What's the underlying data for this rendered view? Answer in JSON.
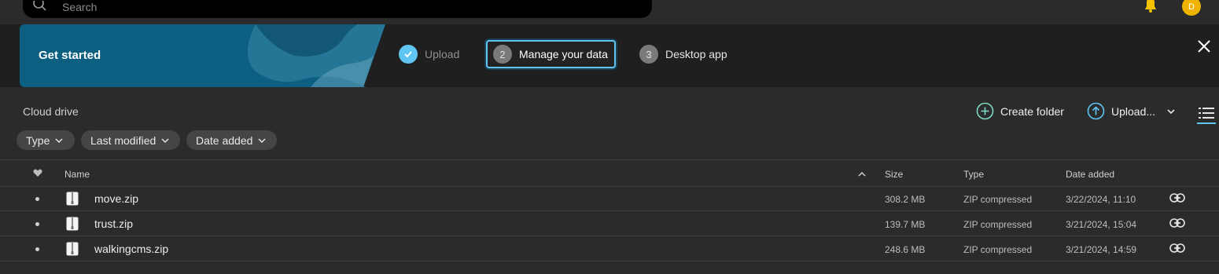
{
  "search": {
    "placeholder": "Search"
  },
  "header": {
    "avatar_initial": "D"
  },
  "banner": {
    "title": "Get started",
    "steps": [
      {
        "number": "",
        "label": "Upload",
        "state": "done"
      },
      {
        "number": "2",
        "label": "Manage your data",
        "state": "active"
      },
      {
        "number": "3",
        "label": "Desktop app",
        "state": "pending"
      }
    ]
  },
  "toolbar": {
    "breadcrumb": "Cloud drive",
    "create_folder": "Create folder",
    "upload": "Upload..."
  },
  "filters": [
    "Type",
    "Last modified",
    "Date added"
  ],
  "table": {
    "columns": {
      "name": "Name",
      "size": "Size",
      "type": "Type",
      "date_added": "Date added"
    },
    "rows": [
      {
        "name": "move.zip",
        "size": "308.2 MB",
        "type": "ZIP compressed",
        "date_added": "3/22/2024, 11:10"
      },
      {
        "name": "trust.zip",
        "size": "139.7 MB",
        "type": "ZIP compressed",
        "date_added": "3/21/2024, 15:04"
      },
      {
        "name": "walkingcms.zip",
        "size": "248.6 MB",
        "type": "ZIP compressed",
        "date_added": "3/21/2024, 14:59"
      }
    ]
  },
  "colors": {
    "accent": "#5fc6f3",
    "create_folder_icon": "#7bd9c4",
    "avatar": "#f0b400",
    "bell": "#f5c400"
  }
}
